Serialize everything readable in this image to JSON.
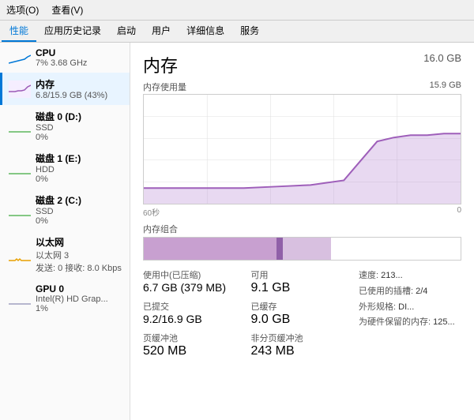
{
  "menubar": {
    "options": "选项(O)",
    "view": "查看(V)"
  },
  "tabs": [
    {
      "label": "性能",
      "active": true
    },
    {
      "label": "应用历史记录"
    },
    {
      "label": "启动"
    },
    {
      "label": "用户"
    },
    {
      "label": "详细信息"
    },
    {
      "label": "服务"
    }
  ],
  "sidebar": {
    "items": [
      {
        "title": "CPU",
        "subtitle": "7% 3.68 GHz",
        "chartColor": "#0078d7",
        "selected": false
      },
      {
        "title": "内存",
        "subtitle": "6.8/15.9 GB (43%)",
        "chartColor": "#9b59b6",
        "selected": true
      },
      {
        "title": "磁盘 0 (D:)",
        "subtitle": "SSD",
        "subtitle2": "0%",
        "chartColor": "#5cb85c",
        "selected": false
      },
      {
        "title": "磁盘 1 (E:)",
        "subtitle": "HDD",
        "subtitle2": "0%",
        "chartColor": "#5cb85c",
        "selected": false
      },
      {
        "title": "磁盘 2 (C:)",
        "subtitle": "SSD",
        "subtitle2": "0%",
        "chartColor": "#5cb85c",
        "selected": false
      },
      {
        "title": "以太网",
        "subtitle": "以太网 3",
        "subtitle2": "发送: 0  接收: 8.0 Kbps",
        "chartColor": "#e8a000",
        "selected": false
      },
      {
        "title": "GPU 0",
        "subtitle": "Intel(R) HD Grap...",
        "subtitle2": "1%",
        "chartColor": "#a0a0c0",
        "selected": false
      }
    ]
  },
  "panel": {
    "title": "内存",
    "total": "16.0 GB",
    "graph_top_label": "内存使用量",
    "graph_top_value": "15.9 GB",
    "time_label_left": "60秒",
    "time_label_right": "0",
    "composition_label": "内存组合",
    "stats": [
      {
        "label": "使用中(已压缩)",
        "value": "6.7 GB (379 MB)"
      },
      {
        "label": "可用",
        "value": "9.1 GB"
      },
      {
        "label": "速度:",
        "value": "213..."
      },
      {
        "label": "已提交",
        "value": "9.2/16.9 GB"
      },
      {
        "label": "已缓存",
        "value": "9.0 GB"
      },
      {
        "label": "已使用的插槽:",
        "value": "2/4"
      },
      {
        "label": "页缓冲池",
        "value": "520 MB"
      },
      {
        "label": "非分页缓冲池",
        "value": "243 MB"
      },
      {
        "label": "外形规格:",
        "value": "DI..."
      }
    ],
    "right_info": [
      {
        "label": "已使用的插槽:",
        "value": "2/4"
      },
      {
        "label": "外形规格:",
        "value": "DI..."
      },
      {
        "label": "为硬件保留的内存:",
        "value": "125..."
      }
    ]
  }
}
